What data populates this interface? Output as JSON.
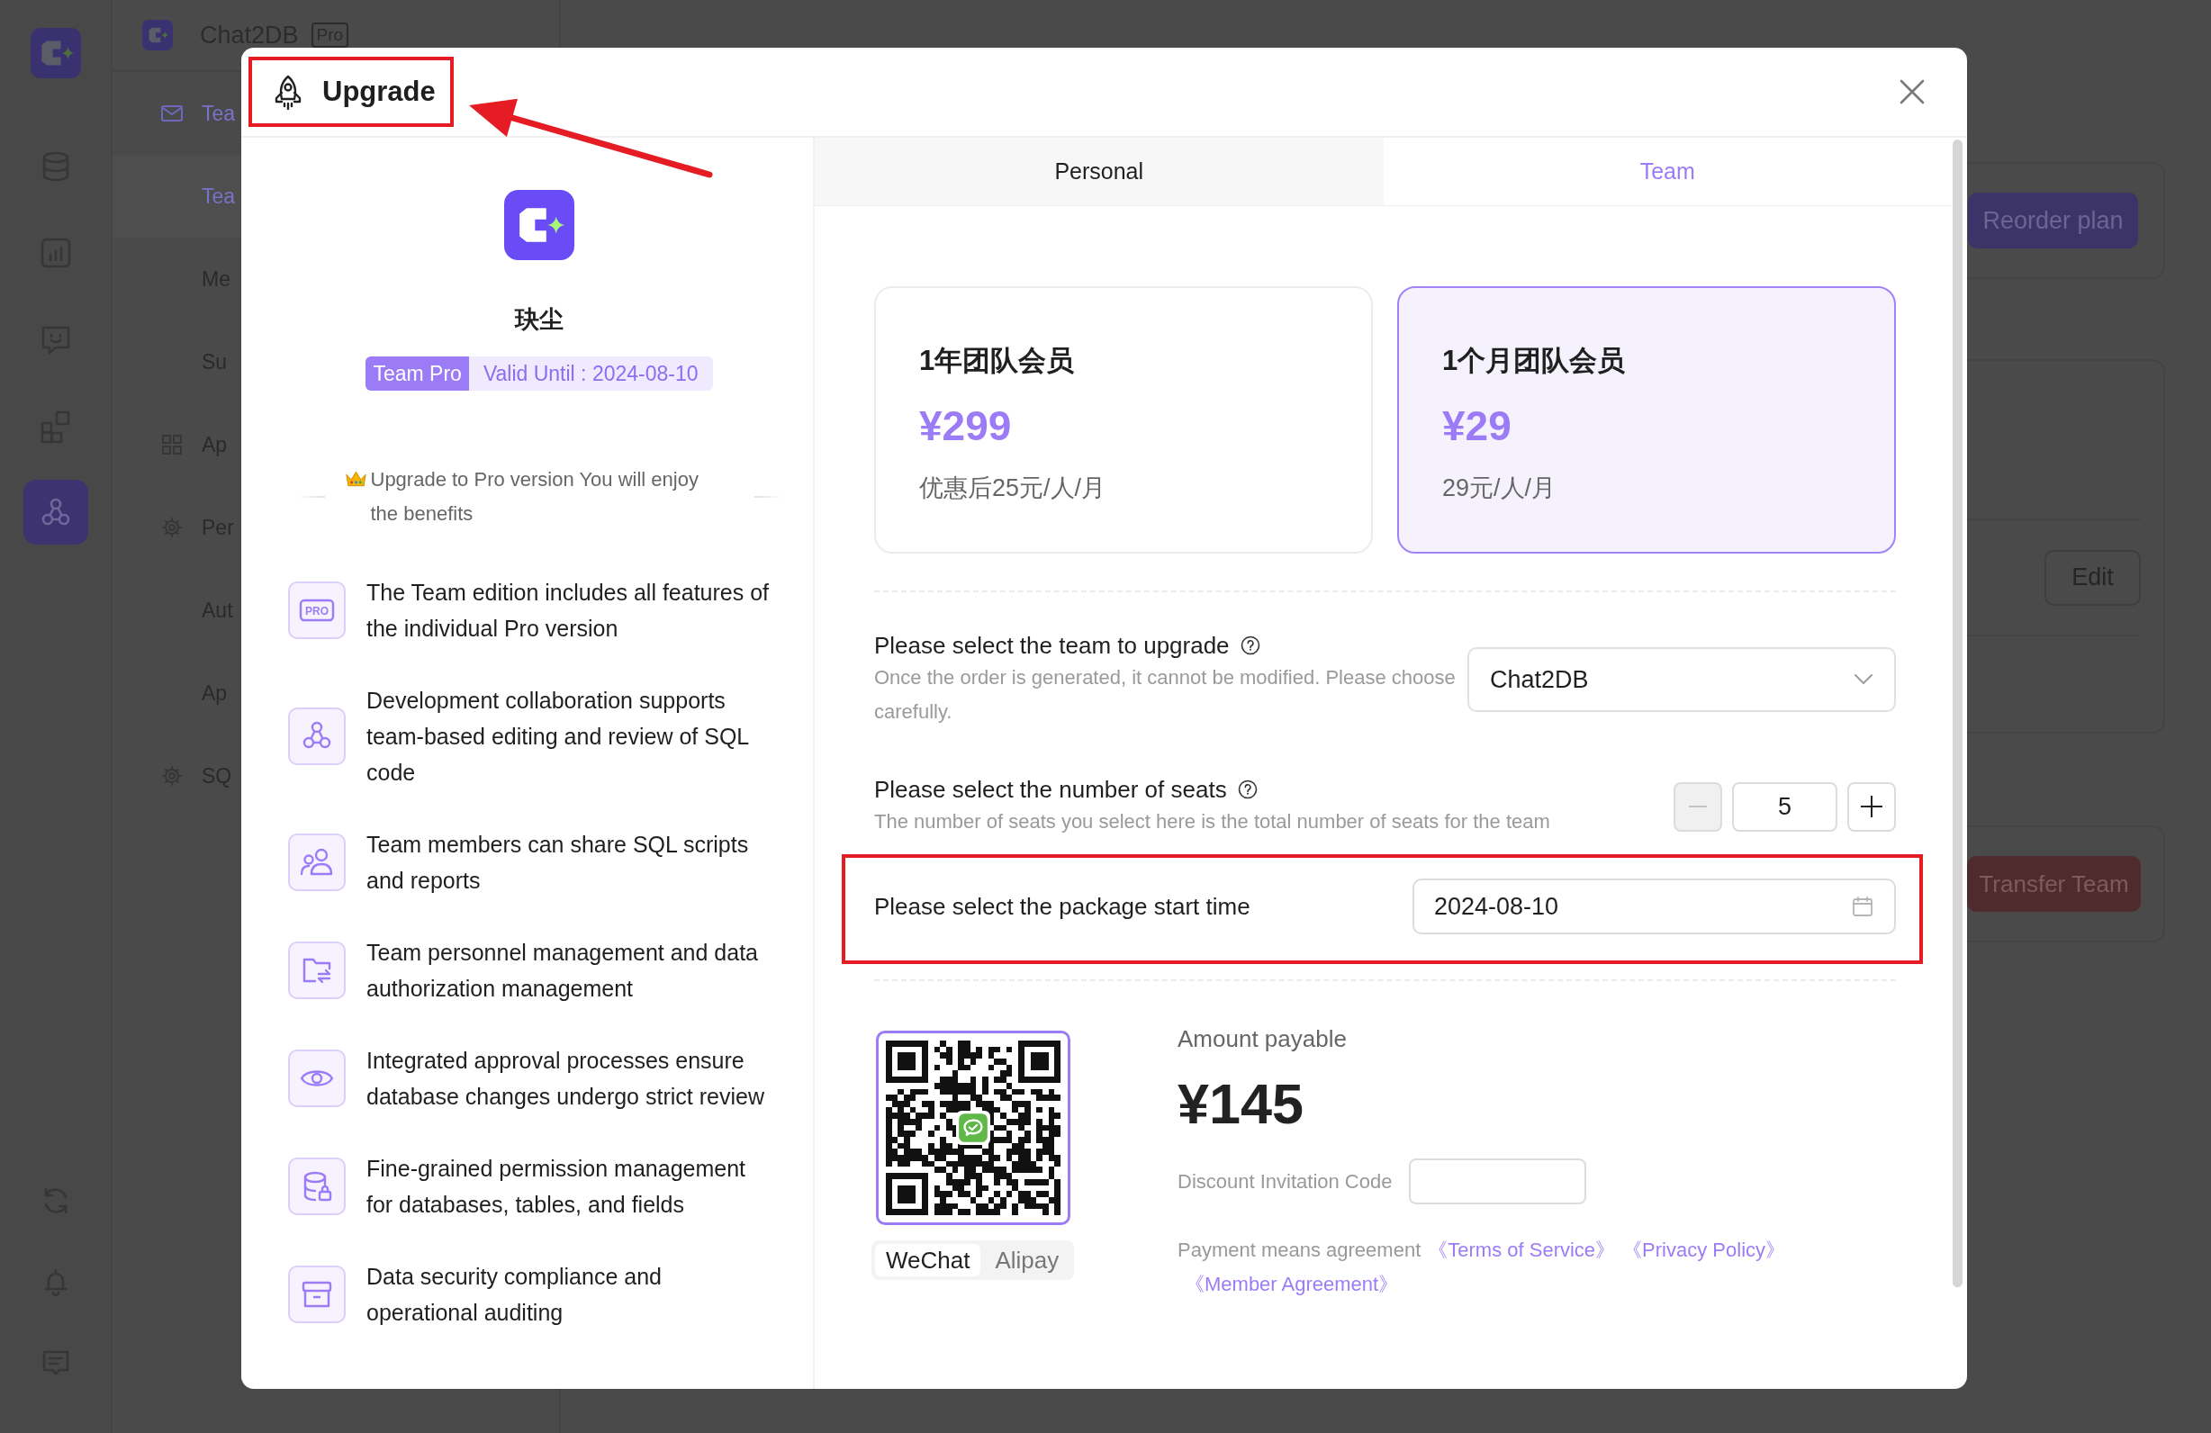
{
  "app": {
    "title": "Chat2DB",
    "badge": "Pro"
  },
  "rail": {
    "items": [
      {
        "selected": false
      },
      {
        "selected": false
      },
      {
        "selected": false
      },
      {
        "selected": false
      },
      {
        "selected": true
      }
    ]
  },
  "sidebar": {
    "groups": [
      {
        "label": "Tea",
        "selected": true,
        "children": [
          {
            "label": "Tea",
            "selected": true
          },
          {
            "label": "Me",
            "selected": false
          },
          {
            "label": "Su",
            "selected": false
          }
        ]
      },
      {
        "label": "Ap",
        "selected": false
      },
      {
        "label": "Per",
        "selected": false,
        "children": [
          {
            "label": "Aut",
            "selected": false
          },
          {
            "label": "Ap",
            "selected": false
          }
        ]
      },
      {
        "label": "SQ",
        "selected": false
      }
    ]
  },
  "background_cards": [
    {
      "buttons": [
        {
          "label": "Reorder plan",
          "kind": "primary"
        }
      ]
    },
    {
      "buttons": [
        {
          "label": "Edit",
          "kind": "default"
        }
      ]
    },
    {
      "buttons": [
        {
          "label": "Transfer Team",
          "kind": "danger"
        }
      ]
    }
  ],
  "dialog": {
    "title": "Upgrade",
    "profile": {
      "name": "玦尘",
      "plan": "Team Pro",
      "valid_until": "Valid Until : 2024-08-10"
    },
    "benefits_intro": "Upgrade to Pro version You will enjoy the benefits",
    "benefits": [
      {
        "text": "The Team edition includes all features of the individual Pro version",
        "icon_text": "PRO"
      },
      {
        "text": "Development collaboration supports team-based editing and review of SQL code"
      },
      {
        "text": "Team members can share SQL scripts and reports"
      },
      {
        "text": "Team personnel management and data authorization management"
      },
      {
        "text": "Integrated approval processes ensure database changes undergo strict review"
      },
      {
        "text": "Fine-grained permission management for databases, tables, and fields"
      },
      {
        "text": "Data security compliance and operational auditing"
      }
    ],
    "tabs": [
      {
        "label": "Personal",
        "selected": false
      },
      {
        "label": "Team",
        "selected": true
      }
    ],
    "plans": [
      {
        "name": "1年团队会员",
        "price": "¥299",
        "note": "优惠后25元/人/月",
        "selected": false
      },
      {
        "name": "1个月团队会员",
        "price": "¥29",
        "note": "29元/人/月",
        "selected": true
      }
    ],
    "team_field": {
      "label": "Please select the team to upgrade",
      "help": "Once the order is generated, it cannot be modified. Please choose carefully.",
      "value": "Chat2DB"
    },
    "seats_field": {
      "label": "Please select the number of seats",
      "help": "The number of seats you select here is the total number of seats for the team",
      "value": "5",
      "decrease": {
        "disabled": true
      },
      "increase": {
        "disabled": false
      }
    },
    "start_field": {
      "label": "Please select the package start time",
      "value": "2024-08-10"
    },
    "payment": {
      "methods": [
        {
          "label": "WeChat",
          "selected": true
        },
        {
          "label": "Alipay",
          "selected": false
        }
      ],
      "amount_label": "Amount payable",
      "amount": "¥145",
      "discount_label": "Discount Invitation Code",
      "agreement": {
        "text": "Payment means agreement",
        "links": [
          "《Terms of Service》",
          "《Privacy Policy》",
          "《Member Agreement》"
        ]
      }
    }
  }
}
